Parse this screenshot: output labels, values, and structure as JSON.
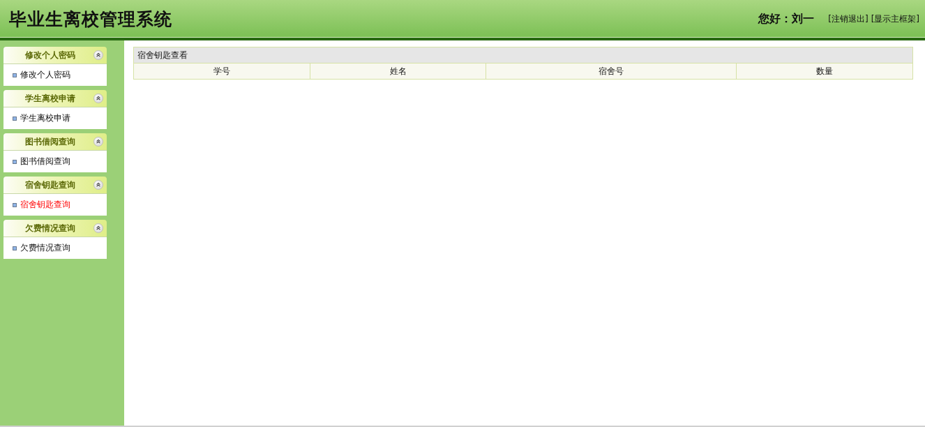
{
  "header": {
    "title": "毕业生离校管理系统",
    "greeting": "您好：刘一",
    "links": [
      "[注销退出]",
      "[显示主框架]"
    ]
  },
  "sidebar": {
    "panels": [
      {
        "title": "修改个人密码",
        "expanded": true,
        "items": [
          {
            "label": "修改个人密码",
            "selected": false
          }
        ]
      },
      {
        "title": "学生离校申请",
        "expanded": true,
        "items": [
          {
            "label": "学生离校申请",
            "selected": false
          }
        ]
      },
      {
        "title": "图书借阅查询",
        "expanded": true,
        "items": [
          {
            "label": "图书借阅查询",
            "selected": false
          }
        ]
      },
      {
        "title": "宿舍钥匙查询",
        "expanded": true,
        "items": [
          {
            "label": "宿舍钥匙查询",
            "selected": true
          }
        ]
      },
      {
        "title": "欠费情况查询",
        "expanded": true,
        "items": [
          {
            "label": "欠费情况查询",
            "selected": false
          }
        ]
      }
    ]
  },
  "content": {
    "table": {
      "title": "宿舍钥匙查看",
      "columns": [
        "学号",
        "姓名",
        "宿舍号",
        "数量"
      ]
    }
  }
}
